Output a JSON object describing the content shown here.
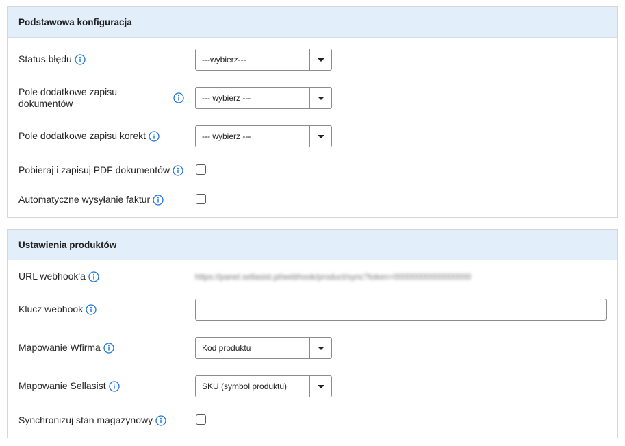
{
  "section1": {
    "title": "Podstawowa konfiguracja",
    "status_label": "Status błędu",
    "status_value": "---wybierz---",
    "docs_field_label": "Pole dodatkowe zapisu dokumentów",
    "docs_field_value": "--- wybierz ---",
    "corrections_label": "Pole dodatkowe zapisu korekt",
    "corrections_value": "--- wybierz ---",
    "pdf_label": "Pobieraj i zapisuj PDF dokumentów",
    "auto_send_label": "Automatyczne wysyłanie faktur"
  },
  "section2": {
    "title": "Ustawienia produktów",
    "webhook_url_label": "URL webhook'a",
    "webhook_url_value": "https://panel.sellasist.pl/webhook/product/sync?token=00000000000000000",
    "webhook_key_label": "Klucz webhook",
    "webhook_key_value": "",
    "wfirma_label": "Mapowanie Wfirma",
    "wfirma_value": "Kod produktu",
    "sellasist_label": "Mapowanie Sellasist",
    "sellasist_value": "SKU (symbol produktu)",
    "sync_stock_label": "Synchronizuj stan magazynowy"
  },
  "icons": {
    "info": "info-circle-icon",
    "dropdown": "caret-down-icon"
  },
  "colors": {
    "header_bg": "#e3eefb",
    "info_icon": "#1a73d9"
  }
}
